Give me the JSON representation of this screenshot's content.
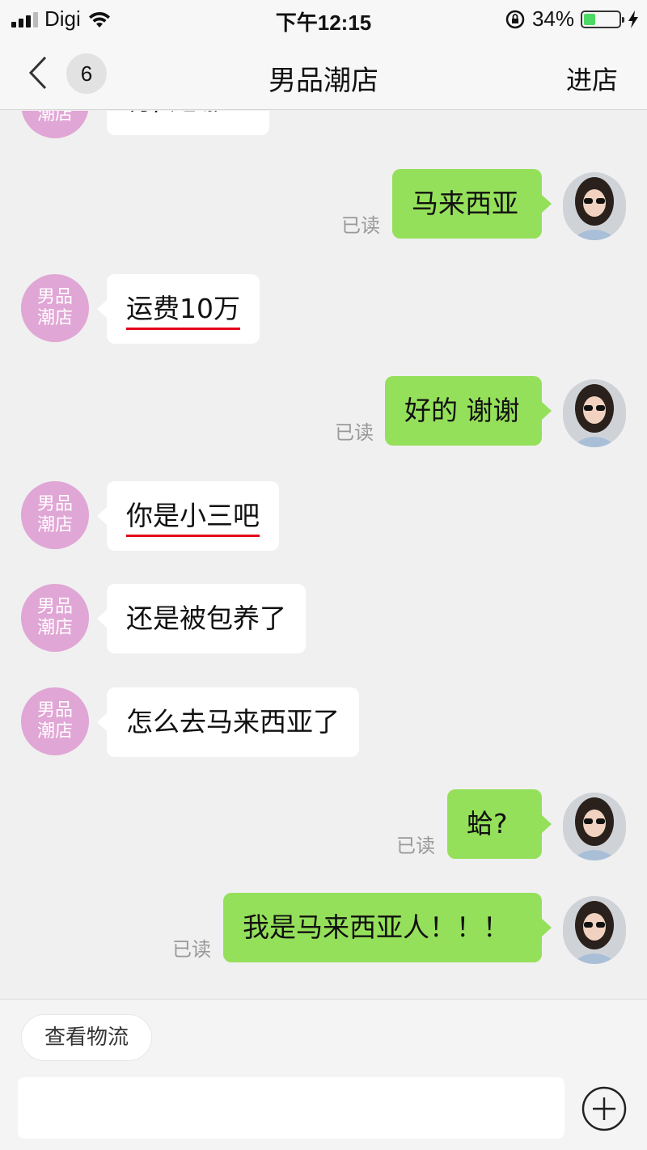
{
  "status_bar": {
    "carrier": "Digi",
    "time": "下午12:15",
    "battery_percent": "34%",
    "battery_level": 0.34
  },
  "nav": {
    "unread_count": "6",
    "title": "男品潮店",
    "enter_store": "进店"
  },
  "shop_avatar_text": {
    "line1": "男品",
    "line2": "潮店"
  },
  "messages": [
    {
      "side": "in",
      "text": "行, 是哪里"
    },
    {
      "side": "out",
      "text": "马来西亚",
      "read": "已读"
    },
    {
      "side": "in",
      "text": "运费10万",
      "underlined": true
    },
    {
      "side": "out",
      "text": "好的 谢谢",
      "read": "已读"
    },
    {
      "side": "in",
      "text": "你是小三吧",
      "underlined": true
    },
    {
      "side": "in",
      "text": "还是被包养了"
    },
    {
      "side": "in",
      "text": "怎么去马来西亚了"
    },
    {
      "side": "out",
      "text": "蛤?",
      "read": "已读"
    },
    {
      "side": "out",
      "text": "我是马来西亚人！！！",
      "read": "已读"
    }
  ],
  "bottom": {
    "logistics_button": "查看物流",
    "input_value": "",
    "input_placeholder": ""
  },
  "icons": {
    "back": "chevron-left-icon",
    "wifi": "wifi-icon",
    "rotation_lock": "rotation-lock-icon",
    "charging": "lightning-bolt-icon",
    "plus": "plus-circle-icon"
  },
  "colors": {
    "outgoing_bubble": "#95e05a",
    "incoming_bubble": "#ffffff",
    "shop_avatar": "#e0a6d5",
    "underline": "#e4001b",
    "battery": "#4cd964"
  }
}
